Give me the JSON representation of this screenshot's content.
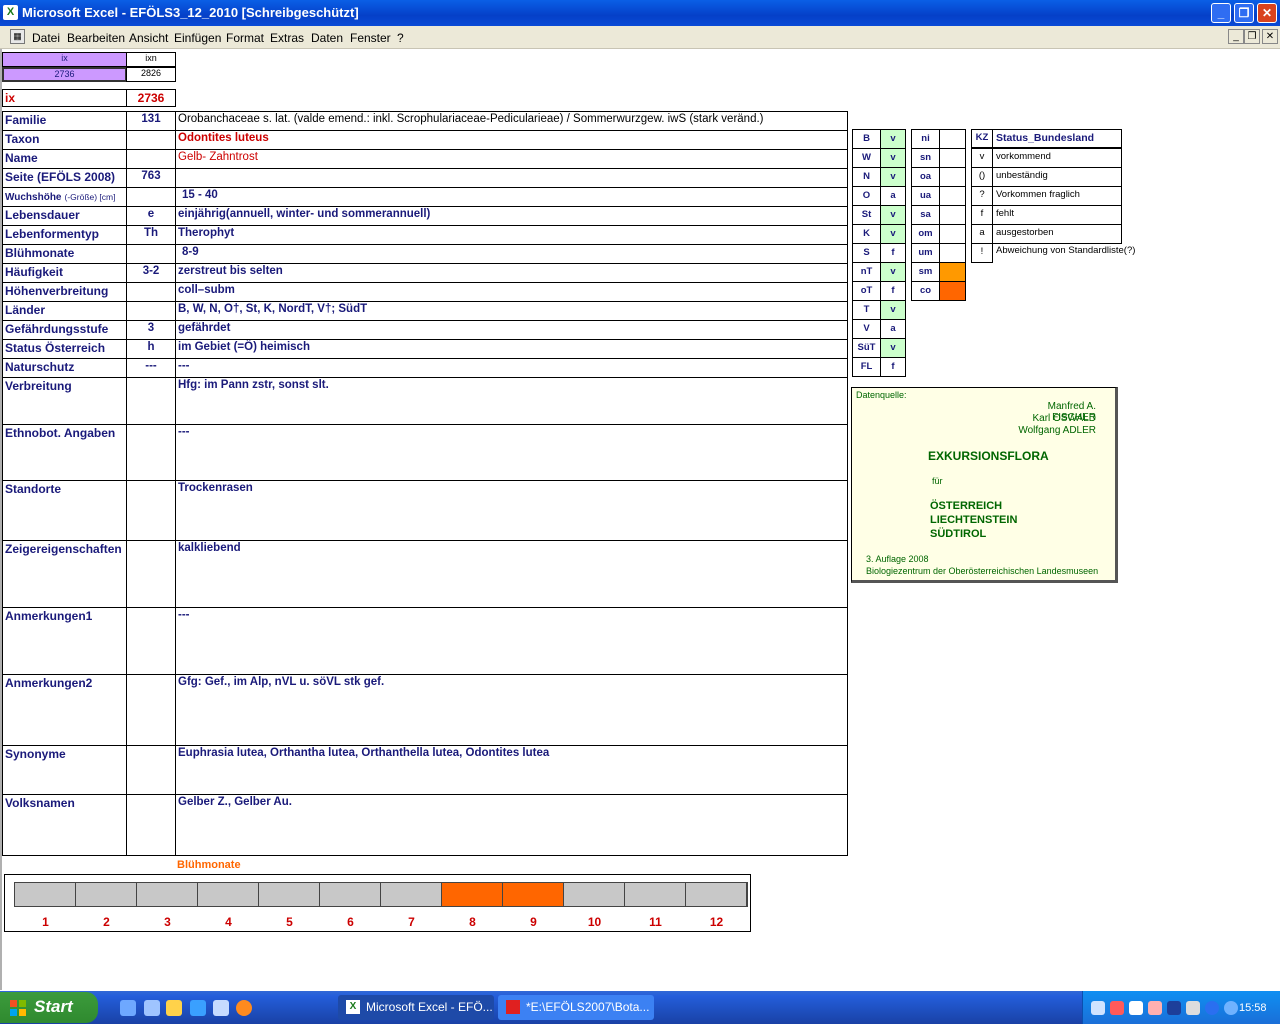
{
  "window": {
    "title": "Microsoft Excel - EFÖLS3_12_2010  [Schreibgeschützt]"
  },
  "menu": [
    "Datei",
    "Bearbeiten",
    "Ansicht",
    "Einfügen",
    "Format",
    "Extras",
    "Daten",
    "Fenster",
    "?"
  ],
  "index_box": {
    "h1": "ix",
    "h2": "ixn",
    "v1": "2736",
    "v2": "2826",
    "ix_label": "ix",
    "ix_value": "2736"
  },
  "rows": [
    {
      "label": "Familie",
      "code": "131",
      "value": "Orobanchaceae s. lat. (valde emend.: inkl. Scrophulariaceae-Pedicularieae)  /  Sommerwurzgew. iwS (stark veränd.)"
    },
    {
      "label": "Taxon",
      "code": "",
      "value": "Odontites luteus"
    },
    {
      "label": "Name",
      "code": "",
      "value": "Gelb- Zahntrost"
    },
    {
      "label": "Seite (EFÖLS 2008)",
      "code": "763",
      "value": ""
    },
    {
      "label": "Wuchshöhe",
      "label_small": "(-Größe) [cm]",
      "code": "",
      "value": "15 - 40"
    },
    {
      "label": "Lebensdauer",
      "code": "e",
      "value": "einjährig(annuell, winter- und sommerannuell)"
    },
    {
      "label": "Lebenformentyp",
      "code": "Th",
      "value": "Therophyt"
    },
    {
      "label": "Blühmonate",
      "code": "",
      "value": "8-9"
    },
    {
      "label": "Häufigkeit",
      "code": "3-2",
      "value": "zerstreut bis selten"
    },
    {
      "label": "Höhenverbreitung",
      "code": "",
      "value": "coll–subm"
    },
    {
      "label": "Länder",
      "code": "",
      "value": "B, W, N, O†, St, K, NordT, V†; SüdT"
    },
    {
      "label": "Gefährdungsstufe",
      "code": "3",
      "value": "gefährdet"
    },
    {
      "label": "Status Österreich",
      "code": "h",
      "value": "im Gebiet (=Ö) heimisch"
    },
    {
      "label": "Naturschutz",
      "code": "---",
      "value": "---"
    },
    {
      "label": "Verbreitung",
      "code": "",
      "value": "Hfg: im Pann zstr, sonst slt."
    },
    {
      "label": "Ethnobot. Angaben",
      "code": "",
      "value": "---"
    },
    {
      "label": "Standorte",
      "code": "",
      "value": "Trockenrasen"
    },
    {
      "label": "Zeigereigenschaften",
      "code": "",
      "value": "kalkliebend"
    },
    {
      "label": "Anmerkungen1",
      "code": "",
      "value": "---"
    },
    {
      "label": "Anmerkungen2",
      "code": "",
      "value": "Gfg: Gef., im Alp, nVL u. söVL stk gef."
    },
    {
      "label": "Synonyme",
      "code": "",
      "value": "Euphrasia lutea, Orthantha lutea, Orthanthella lutea, Odontites lutea"
    },
    {
      "label": "Volksnamen",
      "code": "",
      "value": "Gelber Z., Gelber Au."
    }
  ],
  "states": [
    {
      "k": "B",
      "v": "v"
    },
    {
      "k": "W",
      "v": "v"
    },
    {
      "k": "N",
      "v": "v"
    },
    {
      "k": "O",
      "v": "a"
    },
    {
      "k": "St",
      "v": "v"
    },
    {
      "k": "K",
      "v": "v"
    },
    {
      "k": "S",
      "v": "f"
    },
    {
      "k": "nT",
      "v": "v"
    },
    {
      "k": "oT",
      "v": "f"
    },
    {
      "k": "T",
      "v": "v"
    },
    {
      "k": "V",
      "v": "a"
    },
    {
      "k": "SüT",
      "v": "v"
    },
    {
      "k": "FL",
      "v": "f"
    }
  ],
  "altitudes": [
    "ni",
    "sn",
    "oa",
    "ua",
    "sa",
    "om",
    "um",
    "sm",
    "co"
  ],
  "legend": {
    "header_kz": "KZ",
    "header_text": "Status_Bundesland",
    "items": [
      {
        "k": "v",
        "t": "vorkommend"
      },
      {
        "k": "()",
        "t": "unbeständig"
      },
      {
        "k": "?",
        "t": "Vorkommen fraglich"
      },
      {
        "k": "f",
        "t": "fehlt"
      },
      {
        "k": "a",
        "t": "ausgestorben"
      },
      {
        "k": "!",
        "t": "Abweichung von Standardliste(?)"
      }
    ]
  },
  "source": {
    "label": "Datenquelle:",
    "authors": [
      "Manfred A. FISCHER",
      "Karl OSWALD",
      "Wolfgang ADLER"
    ],
    "title": "EXKURSIONSFLORA",
    "fuer": "für",
    "countries": [
      "ÖSTERREICH",
      "LIECHTENSTEIN",
      "SÜDTIROL"
    ],
    "edition": "3. Auflage 2008",
    "publisher": "Biologiezentrum der Oberösterreichischen Landesmuseen"
  },
  "bloom": {
    "title": "Blühmonate",
    "months": [
      "1",
      "2",
      "3",
      "4",
      "5",
      "6",
      "7",
      "8",
      "9",
      "10",
      "11",
      "12"
    ],
    "flowering": [
      8,
      9
    ],
    "color_on": "#ff6600",
    "color_off": "#c8c8c8"
  },
  "taskbar": {
    "start": "Start",
    "items": [
      "Microsoft Excel - EFÖ...",
      "*E:\\EFÖLS2007\\Bota..."
    ],
    "clock": "15:58"
  }
}
